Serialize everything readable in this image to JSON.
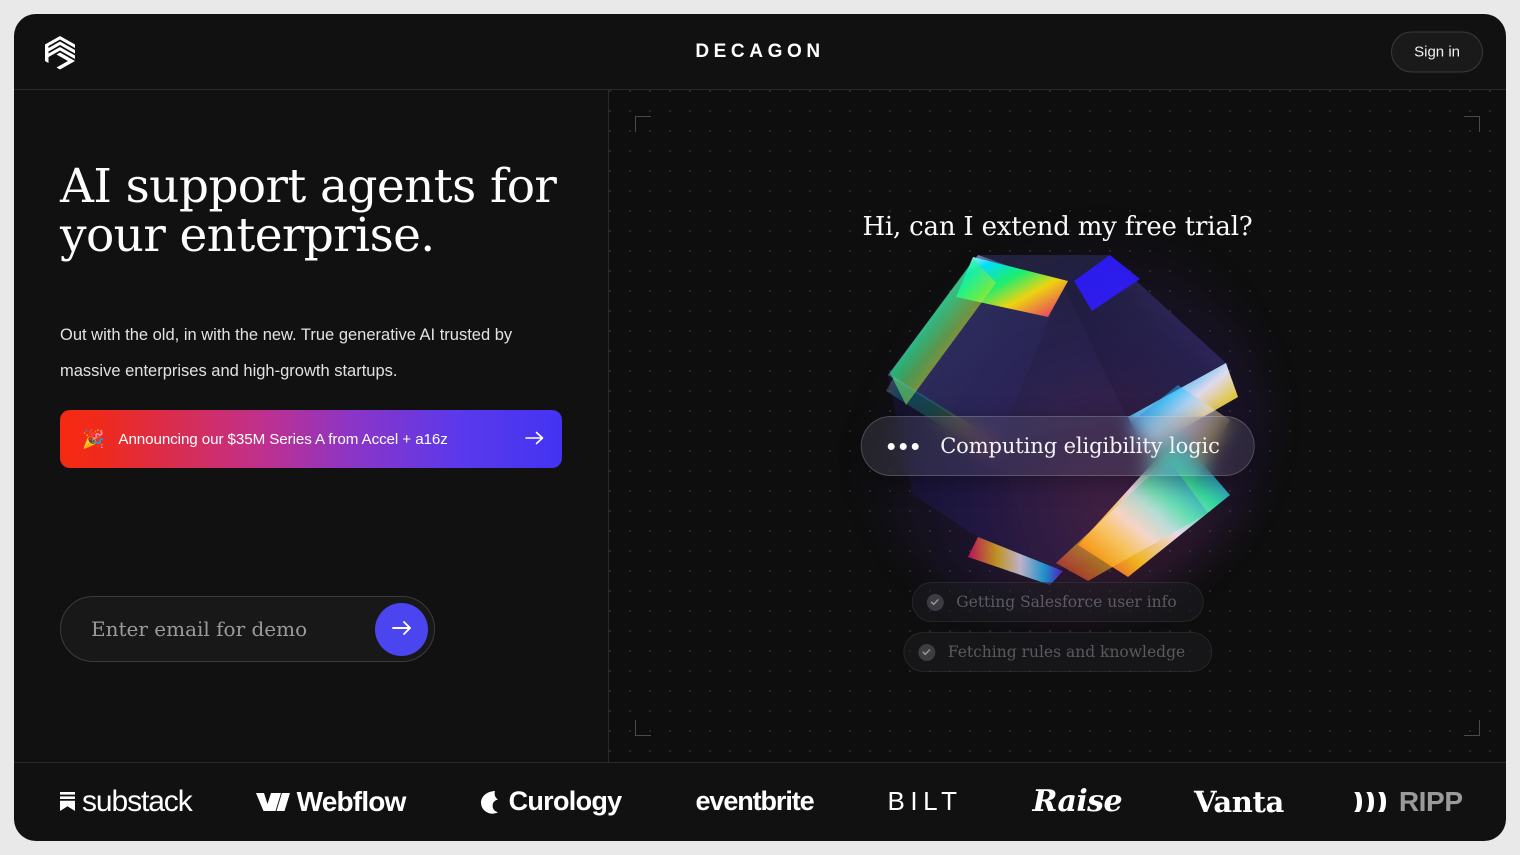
{
  "header": {
    "logo_icon": "decagon-hexagon-logo-icon",
    "brand": "DECAGON",
    "signin_label": "Sign in"
  },
  "hero": {
    "headline": "AI support agents for your enterprise.",
    "subhead": "Out with the old, in with the new. True generative AI trusted by massive enterprises and high-growth startups.",
    "announcement": {
      "emoji": "🎉",
      "text": "Announcing our $35M Series A from Accel + a16z",
      "arrow_icon": "arrow-right-icon",
      "gradient_start": "#f62a12",
      "gradient_mid": "#8c35c6",
      "gradient_end": "#4334f2"
    },
    "email_form": {
      "placeholder": "Enter email for demo",
      "value": "",
      "submit_icon": "arrow-right-icon",
      "submit_color": "#4b45f0"
    }
  },
  "demo": {
    "user_message": "Hi, can I extend my free trial?",
    "graphic": "iridescent-prism-polyhedron",
    "active_status": {
      "typing_icon": "three-dots-typing-icon",
      "text": "Computing eligibility logic"
    },
    "completed_steps": [
      {
        "icon": "check-circle-icon",
        "text": "Getting Salesforce user info"
      },
      {
        "icon": "check-circle-icon",
        "text": "Fetching rules and knowledge"
      }
    ]
  },
  "logos": [
    {
      "name": "substack",
      "label": "substack"
    },
    {
      "name": "webflow",
      "label": "Webflow"
    },
    {
      "name": "curology",
      "label": "Curology"
    },
    {
      "name": "eventbrite",
      "label": "eventbrite"
    },
    {
      "name": "bilt",
      "label": "BILT"
    },
    {
      "name": "raise",
      "label": "Raise"
    },
    {
      "name": "vanta",
      "label": "Vanta"
    },
    {
      "name": "rippling",
      "label": "RIPP"
    }
  ]
}
